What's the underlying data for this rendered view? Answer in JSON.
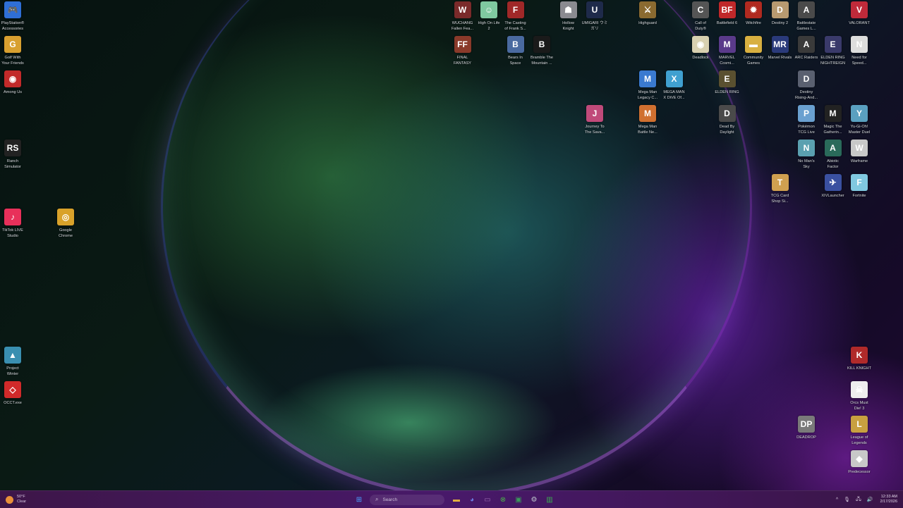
{
  "desktop_icons": [
    {
      "label": "PlayStation®\nAccessories",
      "glyph": "🎮",
      "color": "#2f6fd6"
    },
    {
      "label": "Golf With\nYour Friends",
      "glyph": "G",
      "color": "#d8a030"
    },
    {
      "label": "Among Us",
      "glyph": "◉",
      "color": "#c22a2a"
    },
    {
      "label": "Ranch\nSimulator",
      "glyph": "RS",
      "color": "#222222"
    },
    {
      "label": "TikTok LIVE\nStudio",
      "glyph": "♪",
      "color": "#e8305a"
    },
    {
      "label": "Google\nChrome",
      "glyph": "◎",
      "color": "#d9a22a"
    },
    {
      "label": "Project\nWinter",
      "glyph": "▲",
      "color": "#3a8fb0"
    },
    {
      "label": "OCCT.exe",
      "glyph": "◇",
      "color": "#d02a2a"
    },
    {
      "label": "WUCHANG\nFallen Fea...",
      "glyph": "W",
      "color": "#7a2a2a"
    },
    {
      "label": "High On Life\n2",
      "glyph": "☺",
      "color": "#7fc9a0"
    },
    {
      "label": "The Casting\nof Frank S...",
      "glyph": "F",
      "color": "#a02828"
    },
    {
      "label": "Hollow\nKnight",
      "glyph": "☗",
      "color": "#8a8a90"
    },
    {
      "label": "UMIGARI ウミ\nガリ",
      "glyph": "U",
      "color": "#1e2a4a"
    },
    {
      "label": "Highguard",
      "glyph": "⚔",
      "color": "#8a6a30"
    },
    {
      "label": "Call of\nDuty®",
      "glyph": "C",
      "color": "#555555"
    },
    {
      "label": "Battlefield 6",
      "glyph": "BF",
      "color": "#c0282a"
    },
    {
      "label": "Witchfire",
      "glyph": "✹",
      "color": "#b02a20"
    },
    {
      "label": "Destiny 2",
      "glyph": "D",
      "color": "#b89a70"
    },
    {
      "label": "Battlestate\nGames L...",
      "glyph": "A",
      "color": "#4a4a4a"
    },
    {
      "label": "VALORANT",
      "glyph": "V",
      "color": "#c02a3a"
    },
    {
      "label": "FINAL\nFANTASY",
      "glyph": "FF",
      "color": "#8a3a2a"
    },
    {
      "label": "Bears In\nSpace",
      "glyph": "B",
      "color": "#4a6aa0"
    },
    {
      "label": "Bramble The\nMountain ...",
      "glyph": "B",
      "color": "#1a1a1a"
    },
    {
      "label": "Deadlock",
      "glyph": "◉",
      "color": "#d8d0b0"
    },
    {
      "label": "MARVEL\nCosmi...",
      "glyph": "M",
      "color": "#5a3a8a"
    },
    {
      "label": "Community\nGames",
      "glyph": "▬",
      "color": "#d8b040"
    },
    {
      "label": "Marvel Rivals",
      "glyph": "MR",
      "color": "#2a3a7a"
    },
    {
      "label": "ARC Raiders",
      "glyph": "A",
      "color": "#3a3a3a"
    },
    {
      "label": "ELDEN RING\nNIGHTREIGN",
      "glyph": "E",
      "color": "#3a3a6a"
    },
    {
      "label": "Need for\nSpeed...",
      "glyph": "N",
      "color": "#dddddd"
    },
    {
      "label": "Mega Man\nLegacy C...",
      "glyph": "M",
      "color": "#3a7ad0"
    },
    {
      "label": "MEGA MAN\nX DiVE Of...",
      "glyph": "X",
      "color": "#40a0d0"
    },
    {
      "label": "ELDEN RING",
      "glyph": "E",
      "color": "#5a5030"
    },
    {
      "label": "Destiny\nRising-And...",
      "glyph": "D",
      "color": "#5a6070"
    },
    {
      "label": "Journey To\nThe Sava...",
      "glyph": "J",
      "color": "#c04a7a"
    },
    {
      "label": "Mega Man\nBattle Ne...",
      "glyph": "M",
      "color": "#d07030"
    },
    {
      "label": "Dead By\nDaylight",
      "glyph": "D",
      "color": "#4a4a4a"
    },
    {
      "label": "Pokémon\nTCG Live",
      "glyph": "P",
      "color": "#6aa0d0"
    },
    {
      "label": "Magic The\nGatherin...",
      "glyph": "M",
      "color": "#222222"
    },
    {
      "label": "Yu-Gi-Oh!\nMaster Duel",
      "glyph": "Y",
      "color": "#5aa0c0"
    },
    {
      "label": "No Man's\nSky",
      "glyph": "N",
      "color": "#5aa0b0"
    },
    {
      "label": "Abiotic\nFactor",
      "glyph": "A",
      "color": "#2a6a5a"
    },
    {
      "label": "Warframe",
      "glyph": "W",
      "color": "#c8c8c8"
    },
    {
      "label": "TCG Card\nShop Si...",
      "glyph": "T",
      "color": "#d0a050"
    },
    {
      "label": "XIVLauncher",
      "glyph": "✈",
      "color": "#3a50a0"
    },
    {
      "label": "Fortnite",
      "glyph": "F",
      "color": "#80c8e0"
    },
    {
      "label": "KILL KNIGHT",
      "glyph": "K",
      "color": "#b02a2a"
    },
    {
      "label": "Orcs Must\nDie! 3",
      "glyph": "☠",
      "color": "#eeeeee"
    },
    {
      "label": "DEADROP",
      "glyph": "DP",
      "color": "#7a7a7a"
    },
    {
      "label": "League of\nLegends",
      "glyph": "L",
      "color": "#c8a040"
    },
    {
      "label": "Predecessor",
      "glyph": "◆",
      "color": "#c8c8c8"
    }
  ],
  "taskbar": {
    "weather": {
      "temp": "50°F",
      "condition": "Clear"
    },
    "search": {
      "placeholder": "Search"
    },
    "apps": [
      {
        "name": "windows-start",
        "glyph": "⊞",
        "color": "#4aa0ff"
      },
      {
        "name": "file-explorer",
        "glyph": "▬",
        "color": "#e0b040"
      },
      {
        "name": "discord",
        "glyph": "◕",
        "color": "#6a7ae0"
      },
      {
        "name": "app",
        "glyph": "▭",
        "color": "#9a6ab0"
      },
      {
        "name": "xbox",
        "glyph": "⊗",
        "color": "#4ab04a"
      },
      {
        "name": "app",
        "glyph": "▣",
        "color": "#3a9a5a"
      },
      {
        "name": "steam",
        "glyph": "⚙",
        "color": "#c0c8d0"
      },
      {
        "name": "app",
        "glyph": "▥",
        "color": "#3ab050"
      }
    ],
    "tray": {
      "chevron": "^",
      "time": "12:33 AM",
      "date": "2/17/2026"
    }
  }
}
